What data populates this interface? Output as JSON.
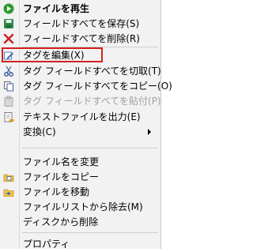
{
  "menu": {
    "items": [
      {
        "label": "ファイルを再生",
        "icon": "play-icon"
      },
      {
        "label": "フィールドすべてを保存(S)",
        "icon": "save-icon"
      },
      {
        "label": "フィールドすべてを削除(R)",
        "icon": "delete-x-icon"
      },
      {
        "label": "タグを編集(X)",
        "icon": "edit-tag-icon"
      },
      {
        "label": "タグ フィールドすべてを切取(T)",
        "icon": "cut-icon"
      },
      {
        "label": "タグ フィールドすべてをコピー(O)",
        "icon": "copy-icon"
      },
      {
        "label": "タグ フィールドすべてを貼付(P)",
        "icon": "paste-icon"
      },
      {
        "label": "テキストファイルを出力(E)",
        "icon": "export-text-icon"
      },
      {
        "label": "変換(C)",
        "icon": ""
      },
      {
        "label": "ファイル名を変更",
        "icon": ""
      },
      {
        "label": "ファイルをコピー",
        "icon": "folder-copy-icon"
      },
      {
        "label": "ファイルを移動",
        "icon": "folder-move-icon"
      },
      {
        "label": "ファイルリストから除去(M)",
        "icon": ""
      },
      {
        "label": "ディスクから削除",
        "icon": ""
      },
      {
        "label": "プロパティ",
        "icon": ""
      }
    ]
  },
  "colors": {
    "highlight_border": "#d32020",
    "play_green": "#2e9a2e",
    "delete_red": "#cc2020"
  }
}
